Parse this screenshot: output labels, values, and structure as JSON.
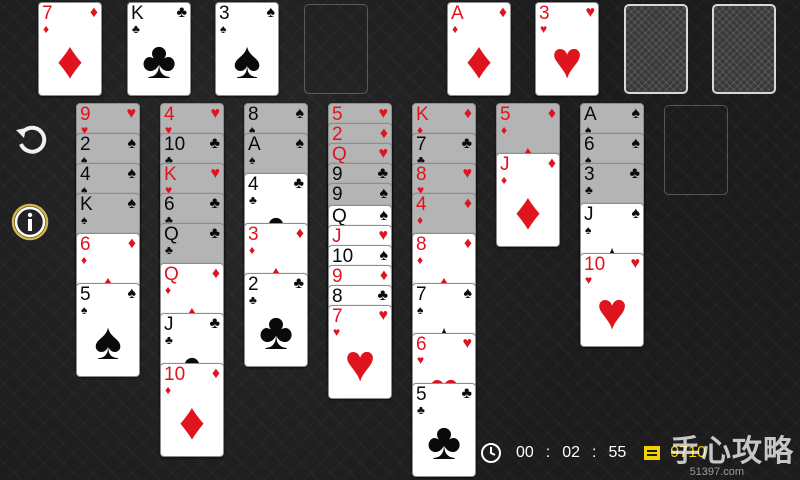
{
  "foundations": [
    {
      "rank": "7",
      "suit": "diamonds"
    },
    {
      "rank": "K",
      "suit": "clubs"
    },
    {
      "rank": "3",
      "suit": "spades"
    },
    null
  ],
  "freecells": [
    {
      "rank": "A",
      "suit": "diamonds"
    },
    {
      "rank": "3",
      "suit": "hearts"
    },
    "back",
    "back"
  ],
  "tableau": [
    [
      {
        "rank": "9",
        "suit": "hearts",
        "dim": true
      },
      {
        "rank": "2",
        "suit": "spades",
        "dim": true
      },
      {
        "rank": "4",
        "suit": "spades",
        "dim": true
      },
      {
        "rank": "K",
        "suit": "spades",
        "dim": true
      },
      {
        "rank": "6",
        "suit": "diamonds"
      },
      {
        "rank": "5",
        "suit": "spades"
      }
    ],
    [
      {
        "rank": "4",
        "suit": "hearts",
        "dim": true
      },
      {
        "rank": "10",
        "suit": "clubs",
        "dim": true
      },
      {
        "rank": "K",
        "suit": "hearts",
        "dim": true
      },
      {
        "rank": "6",
        "suit": "clubs",
        "dim": true
      },
      {
        "rank": "Q",
        "suit": "clubs",
        "dim": true
      },
      {
        "rank": "Q",
        "suit": "diamonds"
      },
      {
        "rank": "J",
        "suit": "clubs"
      },
      {
        "rank": "10",
        "suit": "diamonds"
      }
    ],
    [
      {
        "rank": "8",
        "suit": "spades",
        "dim": true
      },
      {
        "rank": "A",
        "suit": "spades",
        "dim": true
      },
      {
        "rank": "4",
        "suit": "clubs"
      },
      {
        "rank": "3",
        "suit": "diamonds"
      },
      {
        "rank": "2",
        "suit": "clubs"
      }
    ],
    [
      {
        "rank": "5",
        "suit": "hearts",
        "dim": true
      },
      {
        "rank": "2",
        "suit": "diamonds",
        "dim": true
      },
      {
        "rank": "Q",
        "suit": "hearts",
        "dim": true
      },
      {
        "rank": "9",
        "suit": "clubs",
        "dim": true
      },
      {
        "rank": "9",
        "suit": "spades",
        "dim": true
      },
      {
        "rank": "Q",
        "suit": "spades"
      },
      {
        "rank": "J",
        "suit": "hearts"
      },
      {
        "rank": "10",
        "suit": "spades"
      },
      {
        "rank": "9",
        "suit": "diamonds"
      },
      {
        "rank": "8",
        "suit": "clubs"
      },
      {
        "rank": "7",
        "suit": "hearts"
      }
    ],
    [
      {
        "rank": "K",
        "suit": "diamonds",
        "dim": true
      },
      {
        "rank": "7",
        "suit": "clubs",
        "dim": true
      },
      {
        "rank": "8",
        "suit": "hearts",
        "dim": true
      },
      {
        "rank": "4",
        "suit": "diamonds",
        "dim": true
      },
      {
        "rank": "8",
        "suit": "diamonds"
      },
      {
        "rank": "7",
        "suit": "spades"
      },
      {
        "rank": "6",
        "suit": "hearts"
      },
      {
        "rank": "5",
        "suit": "clubs"
      }
    ],
    [
      {
        "rank": "5",
        "suit": "diamonds",
        "dim": true
      },
      {
        "rank": "J",
        "suit": "diamonds"
      }
    ],
    [
      {
        "rank": "A",
        "suit": "spades",
        "dim": true
      },
      {
        "rank": "6",
        "suit": "spades",
        "dim": true
      },
      {
        "rank": "3",
        "suit": "clubs",
        "dim": true
      },
      {
        "rank": "J",
        "suit": "spades"
      },
      {
        "rank": "10",
        "suit": "hearts"
      }
    ],
    []
  ],
  "hud": {
    "time_h": "00",
    "time_sep1": ":",
    "time_m": "02",
    "time_sep2": ":",
    "time_s": "55",
    "score": "9710"
  },
  "icons": {
    "undo": "undo-icon",
    "info": "info-icon",
    "clock": "clock-icon",
    "score": "score-icon"
  },
  "colors": {
    "red": "#e0141e",
    "black": "#0a0a0a",
    "score": "#f2d200"
  },
  "watermark": {
    "main": "手心攻略",
    "sub": "51397.com"
  }
}
